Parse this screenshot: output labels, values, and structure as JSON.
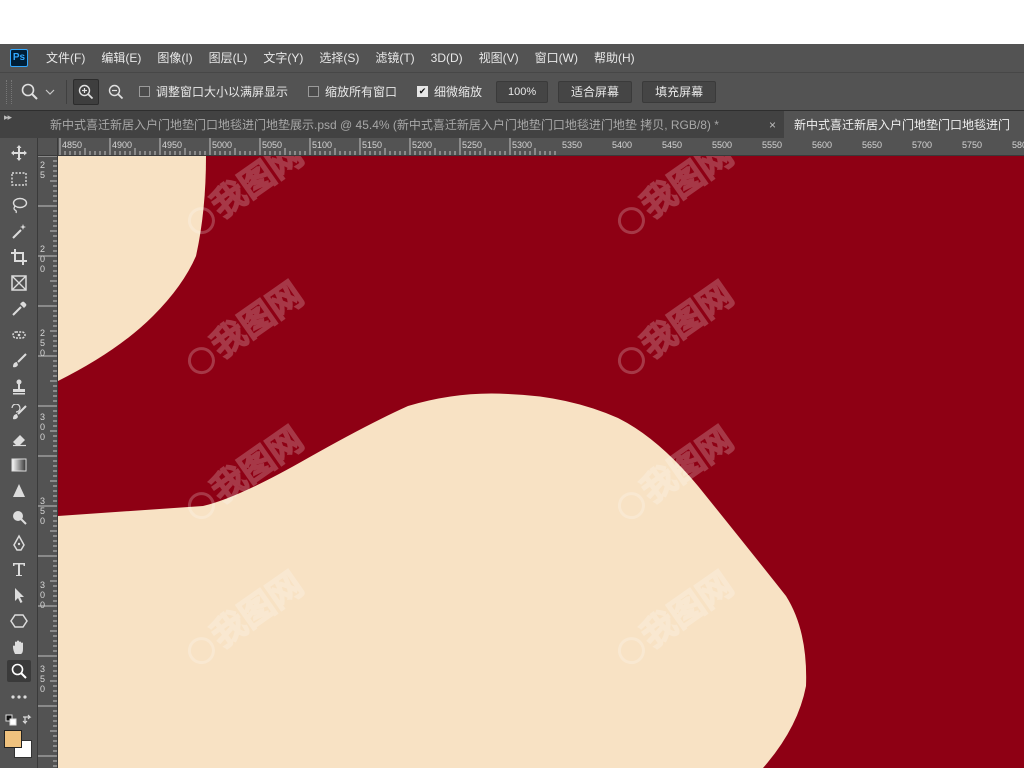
{
  "app": {
    "logo_text": "Ps"
  },
  "menu": [
    "文件(F)",
    "编辑(E)",
    "图像(I)",
    "图层(L)",
    "文字(Y)",
    "选择(S)",
    "滤镜(T)",
    "3D(D)",
    "视图(V)",
    "窗口(W)",
    "帮助(H)"
  ],
  "options": {
    "resize_windows_label": "调整窗口大小以满屏显示",
    "resize_windows_checked": false,
    "zoom_all_label": "缩放所有窗口",
    "zoom_all_checked": false,
    "scrubby_zoom_label": "细微缩放",
    "scrubby_zoom_checked": true,
    "percent": "100%",
    "fit_screen_label": "适合屏幕",
    "fill_screen_label": "填充屏幕"
  },
  "tabs": [
    {
      "title": "新中式喜迁新居入户门地垫门口地毯进门地垫展示.psd @ 45.4% (新中式喜迁新居入户门地垫门口地毯进门地垫 拷贝, RGB/8) *",
      "active": false,
      "close": "×"
    },
    {
      "title": "新中式喜迁新居入户门地垫门口地毯进门",
      "active": true
    }
  ],
  "ruler_top": [
    "4850",
    "4900",
    "4950",
    "5000",
    "5050",
    "5100",
    "5150",
    "5200",
    "5250",
    "5300",
    "5350",
    "5400",
    "5450",
    "5500",
    "5550",
    "5600",
    "5650",
    "5700",
    "5750",
    "580"
  ],
  "ruler_left": [
    [
      "2",
      "5"
    ],
    [
      "2",
      "0",
      "0"
    ],
    [
      "2",
      "5",
      "0"
    ],
    [
      "3",
      "0",
      "0"
    ],
    [
      "3",
      "5",
      "0"
    ],
    [
      "3",
      "0",
      "0"
    ],
    [
      "3",
      "5",
      "0"
    ]
  ],
  "tools": [
    "move-tool",
    "marquee-tool",
    "lasso-tool",
    "magic-wand-tool",
    "crop-tool",
    "frame-tool",
    "eyedropper-tool",
    "healing-brush-tool",
    "brush-tool",
    "clone-stamp-tool",
    "history-brush-tool",
    "eraser-tool",
    "gradient-tool",
    "blur-tool",
    "dodge-tool",
    "pen-tool",
    "type-tool",
    "path-selection-tool",
    "shape-tool",
    "hand-tool",
    "zoom-tool",
    "more-tools"
  ],
  "active_tool": "zoom-tool",
  "colors": {
    "canvas_red": "#8e0014",
    "shape_cream": "#f8e2c4",
    "foreground": "#f0c27e",
    "background": "#ffffff",
    "ui_panel": "#535353",
    "ui_dark": "#424242"
  },
  "watermark_text": "我图网"
}
